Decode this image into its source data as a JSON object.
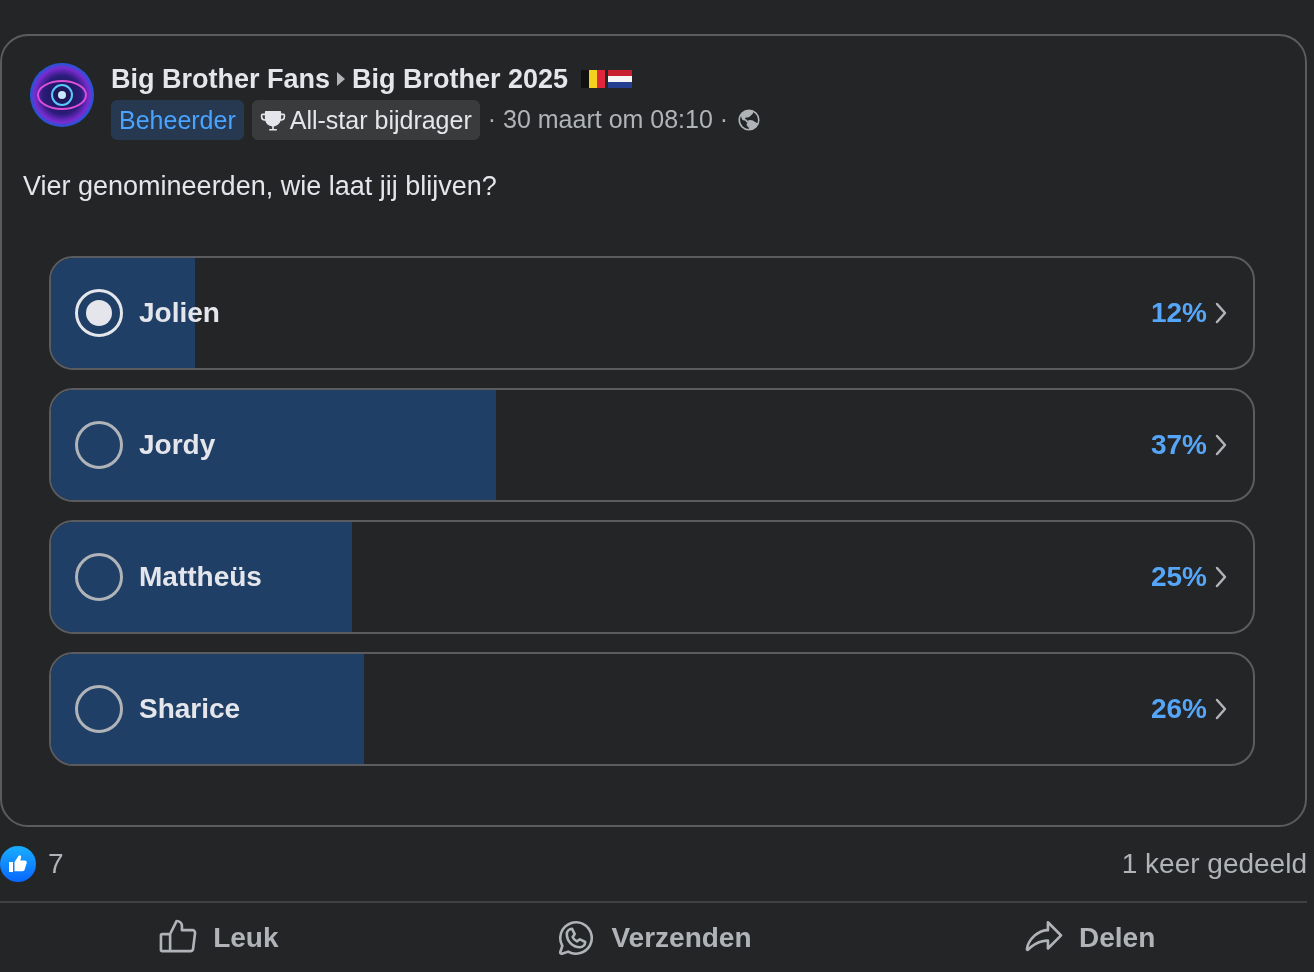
{
  "post": {
    "group": "Big Brother Fans",
    "subgroup": "Big Brother 2025",
    "badges": [
      {
        "kind": "role",
        "label": "Beheerder"
      },
      {
        "kind": "award",
        "label": "All-star bijdrager"
      }
    ],
    "meta": "· 30 maart om 08:10 ·",
    "text": "Vier genomineerden, wie laat jij blijven?"
  },
  "poll": {
    "options": [
      {
        "label": "Jolien",
        "selected": true,
        "level": 0.12,
        "percent": "12%"
      },
      {
        "label": "Jordy",
        "selected": false,
        "level": 0.37,
        "percent": "37%"
      },
      {
        "label": "Mattheüs",
        "selected": false,
        "level": 0.25,
        "percent": "25%"
      },
      {
        "label": "Sharice",
        "selected": false,
        "level": 0.26,
        "percent": "26%"
      }
    ]
  },
  "reactions": {
    "count": "7",
    "shares": "1 keer gedeeld"
  },
  "actions": [
    {
      "kind": "like",
      "label": "Leuk"
    },
    {
      "kind": "send",
      "label": "Verzenden"
    },
    {
      "kind": "share",
      "label": "Delen"
    }
  ]
}
